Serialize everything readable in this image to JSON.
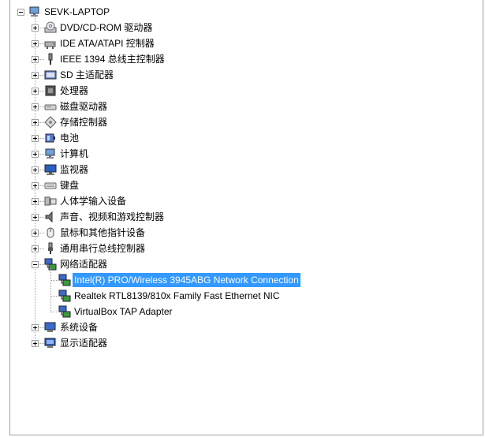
{
  "tree": {
    "root": {
      "label": "SEVK-LAPTOP",
      "icon": "computer-icon"
    },
    "categories": [
      {
        "label": "DVD/CD-ROM 驱动器",
        "icon": "dvd-drive-icon"
      },
      {
        "label": "IDE ATA/ATAPI 控制器",
        "icon": "ide-controller-icon"
      },
      {
        "label": "IEEE 1394 总线主控制器",
        "icon": "ieee1394-icon"
      },
      {
        "label": "SD 主适配器",
        "icon": "sd-adapter-icon"
      },
      {
        "label": "处理器",
        "icon": "processor-icon"
      },
      {
        "label": "磁盘驱动器",
        "icon": "disk-drive-icon"
      },
      {
        "label": "存储控制器",
        "icon": "storage-controller-icon"
      },
      {
        "label": "电池",
        "icon": "battery-icon"
      },
      {
        "label": "计算机",
        "icon": "computer-icon"
      },
      {
        "label": "监视器",
        "icon": "monitor-icon"
      },
      {
        "label": "键盘",
        "icon": "keyboard-icon"
      },
      {
        "label": "人体学输入设备",
        "icon": "hid-icon"
      },
      {
        "label": "声音、视频和游戏控制器",
        "icon": "sound-icon"
      },
      {
        "label": "鼠标和其他指针设备",
        "icon": "mouse-icon"
      },
      {
        "label": "通用串行总线控制器",
        "icon": "usb-icon"
      },
      {
        "label": "网络适配器",
        "icon": "network-adapter-icon",
        "expanded": true
      },
      {
        "label": "系统设备",
        "icon": "system-devices-icon"
      },
      {
        "label": "显示适配器",
        "icon": "display-adapter-icon"
      }
    ],
    "network_children": [
      {
        "label": "Intel(R) PRO/Wireless 3945ABG Network Connection",
        "selected": true
      },
      {
        "label": "Realtek RTL8139/810x Family Fast Ethernet NIC",
        "selected": false
      },
      {
        "label": "VirtualBox TAP Adapter",
        "selected": false
      }
    ]
  },
  "colors": {
    "selection": "#3399ff",
    "tree_line": "#a0a0a0"
  }
}
